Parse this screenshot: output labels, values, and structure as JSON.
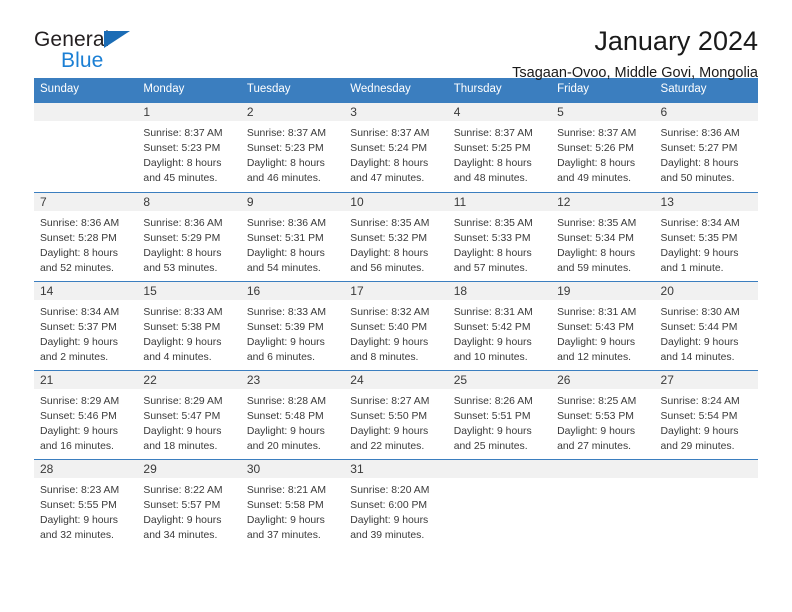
{
  "brand": {
    "name_top": "General",
    "name_bottom": "Blue",
    "triangle_color": "#1b6cb5",
    "blue_text_color": "#1b7fd4"
  },
  "header": {
    "title": "January 2024",
    "subtitle": "Tsagaan-Ovoo, Middle Govi, Mongolia"
  },
  "theme": {
    "header_band": "#3b7ebf",
    "daynum_band": "#f1f1f1",
    "text": "#3a3a3a"
  },
  "weekday_headers": [
    "Sunday",
    "Monday",
    "Tuesday",
    "Wednesday",
    "Thursday",
    "Friday",
    "Saturday"
  ],
  "weeks": [
    [
      {
        "day": "",
        "sunrise": "",
        "sunset": "",
        "daylight_line1": "",
        "daylight_line2": ""
      },
      {
        "day": "1",
        "sunrise": "Sunrise: 8:37 AM",
        "sunset": "Sunset: 5:23 PM",
        "daylight_line1": "Daylight: 8 hours",
        "daylight_line2": "and 45 minutes."
      },
      {
        "day": "2",
        "sunrise": "Sunrise: 8:37 AM",
        "sunset": "Sunset: 5:23 PM",
        "daylight_line1": "Daylight: 8 hours",
        "daylight_line2": "and 46 minutes."
      },
      {
        "day": "3",
        "sunrise": "Sunrise: 8:37 AM",
        "sunset": "Sunset: 5:24 PM",
        "daylight_line1": "Daylight: 8 hours",
        "daylight_line2": "and 47 minutes."
      },
      {
        "day": "4",
        "sunrise": "Sunrise: 8:37 AM",
        "sunset": "Sunset: 5:25 PM",
        "daylight_line1": "Daylight: 8 hours",
        "daylight_line2": "and 48 minutes."
      },
      {
        "day": "5",
        "sunrise": "Sunrise: 8:37 AM",
        "sunset": "Sunset: 5:26 PM",
        "daylight_line1": "Daylight: 8 hours",
        "daylight_line2": "and 49 minutes."
      },
      {
        "day": "6",
        "sunrise": "Sunrise: 8:36 AM",
        "sunset": "Sunset: 5:27 PM",
        "daylight_line1": "Daylight: 8 hours",
        "daylight_line2": "and 50 minutes."
      }
    ],
    [
      {
        "day": "7",
        "sunrise": "Sunrise: 8:36 AM",
        "sunset": "Sunset: 5:28 PM",
        "daylight_line1": "Daylight: 8 hours",
        "daylight_line2": "and 52 minutes."
      },
      {
        "day": "8",
        "sunrise": "Sunrise: 8:36 AM",
        "sunset": "Sunset: 5:29 PM",
        "daylight_line1": "Daylight: 8 hours",
        "daylight_line2": "and 53 minutes."
      },
      {
        "day": "9",
        "sunrise": "Sunrise: 8:36 AM",
        "sunset": "Sunset: 5:31 PM",
        "daylight_line1": "Daylight: 8 hours",
        "daylight_line2": "and 54 minutes."
      },
      {
        "day": "10",
        "sunrise": "Sunrise: 8:35 AM",
        "sunset": "Sunset: 5:32 PM",
        "daylight_line1": "Daylight: 8 hours",
        "daylight_line2": "and 56 minutes."
      },
      {
        "day": "11",
        "sunrise": "Sunrise: 8:35 AM",
        "sunset": "Sunset: 5:33 PM",
        "daylight_line1": "Daylight: 8 hours",
        "daylight_line2": "and 57 minutes."
      },
      {
        "day": "12",
        "sunrise": "Sunrise: 8:35 AM",
        "sunset": "Sunset: 5:34 PM",
        "daylight_line1": "Daylight: 8 hours",
        "daylight_line2": "and 59 minutes."
      },
      {
        "day": "13",
        "sunrise": "Sunrise: 8:34 AM",
        "sunset": "Sunset: 5:35 PM",
        "daylight_line1": "Daylight: 9 hours",
        "daylight_line2": "and 1 minute."
      }
    ],
    [
      {
        "day": "14",
        "sunrise": "Sunrise: 8:34 AM",
        "sunset": "Sunset: 5:37 PM",
        "daylight_line1": "Daylight: 9 hours",
        "daylight_line2": "and 2 minutes."
      },
      {
        "day": "15",
        "sunrise": "Sunrise: 8:33 AM",
        "sunset": "Sunset: 5:38 PM",
        "daylight_line1": "Daylight: 9 hours",
        "daylight_line2": "and 4 minutes."
      },
      {
        "day": "16",
        "sunrise": "Sunrise: 8:33 AM",
        "sunset": "Sunset: 5:39 PM",
        "daylight_line1": "Daylight: 9 hours",
        "daylight_line2": "and 6 minutes."
      },
      {
        "day": "17",
        "sunrise": "Sunrise: 8:32 AM",
        "sunset": "Sunset: 5:40 PM",
        "daylight_line1": "Daylight: 9 hours",
        "daylight_line2": "and 8 minutes."
      },
      {
        "day": "18",
        "sunrise": "Sunrise: 8:31 AM",
        "sunset": "Sunset: 5:42 PM",
        "daylight_line1": "Daylight: 9 hours",
        "daylight_line2": "and 10 minutes."
      },
      {
        "day": "19",
        "sunrise": "Sunrise: 8:31 AM",
        "sunset": "Sunset: 5:43 PM",
        "daylight_line1": "Daylight: 9 hours",
        "daylight_line2": "and 12 minutes."
      },
      {
        "day": "20",
        "sunrise": "Sunrise: 8:30 AM",
        "sunset": "Sunset: 5:44 PM",
        "daylight_line1": "Daylight: 9 hours",
        "daylight_line2": "and 14 minutes."
      }
    ],
    [
      {
        "day": "21",
        "sunrise": "Sunrise: 8:29 AM",
        "sunset": "Sunset: 5:46 PM",
        "daylight_line1": "Daylight: 9 hours",
        "daylight_line2": "and 16 minutes."
      },
      {
        "day": "22",
        "sunrise": "Sunrise: 8:29 AM",
        "sunset": "Sunset: 5:47 PM",
        "daylight_line1": "Daylight: 9 hours",
        "daylight_line2": "and 18 minutes."
      },
      {
        "day": "23",
        "sunrise": "Sunrise: 8:28 AM",
        "sunset": "Sunset: 5:48 PM",
        "daylight_line1": "Daylight: 9 hours",
        "daylight_line2": "and 20 minutes."
      },
      {
        "day": "24",
        "sunrise": "Sunrise: 8:27 AM",
        "sunset": "Sunset: 5:50 PM",
        "daylight_line1": "Daylight: 9 hours",
        "daylight_line2": "and 22 minutes."
      },
      {
        "day": "25",
        "sunrise": "Sunrise: 8:26 AM",
        "sunset": "Sunset: 5:51 PM",
        "daylight_line1": "Daylight: 9 hours",
        "daylight_line2": "and 25 minutes."
      },
      {
        "day": "26",
        "sunrise": "Sunrise: 8:25 AM",
        "sunset": "Sunset: 5:53 PM",
        "daylight_line1": "Daylight: 9 hours",
        "daylight_line2": "and 27 minutes."
      },
      {
        "day": "27",
        "sunrise": "Sunrise: 8:24 AM",
        "sunset": "Sunset: 5:54 PM",
        "daylight_line1": "Daylight: 9 hours",
        "daylight_line2": "and 29 minutes."
      }
    ],
    [
      {
        "day": "28",
        "sunrise": "Sunrise: 8:23 AM",
        "sunset": "Sunset: 5:55 PM",
        "daylight_line1": "Daylight: 9 hours",
        "daylight_line2": "and 32 minutes."
      },
      {
        "day": "29",
        "sunrise": "Sunrise: 8:22 AM",
        "sunset": "Sunset: 5:57 PM",
        "daylight_line1": "Daylight: 9 hours",
        "daylight_line2": "and 34 minutes."
      },
      {
        "day": "30",
        "sunrise": "Sunrise: 8:21 AM",
        "sunset": "Sunset: 5:58 PM",
        "daylight_line1": "Daylight: 9 hours",
        "daylight_line2": "and 37 minutes."
      },
      {
        "day": "31",
        "sunrise": "Sunrise: 8:20 AM",
        "sunset": "Sunset: 6:00 PM",
        "daylight_line1": "Daylight: 9 hours",
        "daylight_line2": "and 39 minutes."
      },
      {
        "day": "",
        "sunrise": "",
        "sunset": "",
        "daylight_line1": "",
        "daylight_line2": ""
      },
      {
        "day": "",
        "sunrise": "",
        "sunset": "",
        "daylight_line1": "",
        "daylight_line2": ""
      },
      {
        "day": "",
        "sunrise": "",
        "sunset": "",
        "daylight_line1": "",
        "daylight_line2": ""
      }
    ]
  ]
}
